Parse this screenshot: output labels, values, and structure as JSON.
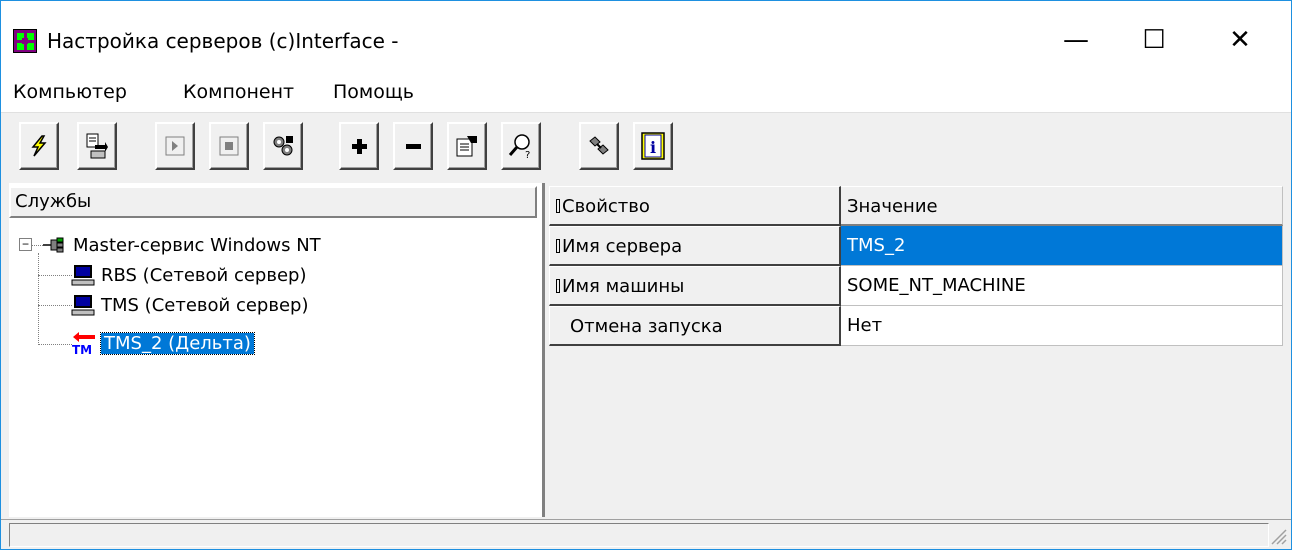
{
  "window": {
    "title": "Настройка серверов (c)Interface -",
    "controls": {
      "minimize": "—",
      "maximize": "☐",
      "close": "✕"
    }
  },
  "menu": {
    "items": [
      {
        "label": "Компьютер"
      },
      {
        "label": "Компонент"
      },
      {
        "label": "Помощь"
      }
    ]
  },
  "toolbar": {
    "buttons": [
      {
        "icon": "lightning-icon"
      },
      {
        "icon": "transfer-icon"
      },
      {
        "icon": "play-icon"
      },
      {
        "icon": "stop-icon"
      },
      {
        "icon": "services-icon"
      },
      {
        "icon": "add-icon"
      },
      {
        "icon": "remove-icon"
      },
      {
        "icon": "properties-icon"
      },
      {
        "icon": "find-icon"
      },
      {
        "icon": "connect-icon"
      },
      {
        "icon": "info-icon"
      }
    ]
  },
  "tree": {
    "header": "Службы",
    "root": {
      "label": "Master-сервис Windows NT",
      "icon": "network-service-icon",
      "expanded": true
    },
    "children": [
      {
        "label": "RBS (Сетевой сервер)",
        "icon": "computer-icon",
        "selected": false
      },
      {
        "label": "TMS (Сетевой сервер)",
        "icon": "computer-icon",
        "selected": false
      },
      {
        "label": "TMS_2 (Дельта)",
        "icon": "tm-delta-icon",
        "selected": true
      }
    ]
  },
  "properties": {
    "headers": {
      "property": "Свойство",
      "value": "Значение"
    },
    "rows": [
      {
        "property": "Имя сервера",
        "value": "TMS_2",
        "selected": true,
        "marked": true
      },
      {
        "property": "Имя машины",
        "value": "SOME_NT_MACHINE",
        "selected": false,
        "marked": true
      },
      {
        "property": "Отмена запуска",
        "value": "Нет",
        "selected": false,
        "marked": false
      }
    ]
  },
  "colors": {
    "selection": "#0078d7",
    "face": "#f0f0f0",
    "frame": "#1e90e0"
  }
}
